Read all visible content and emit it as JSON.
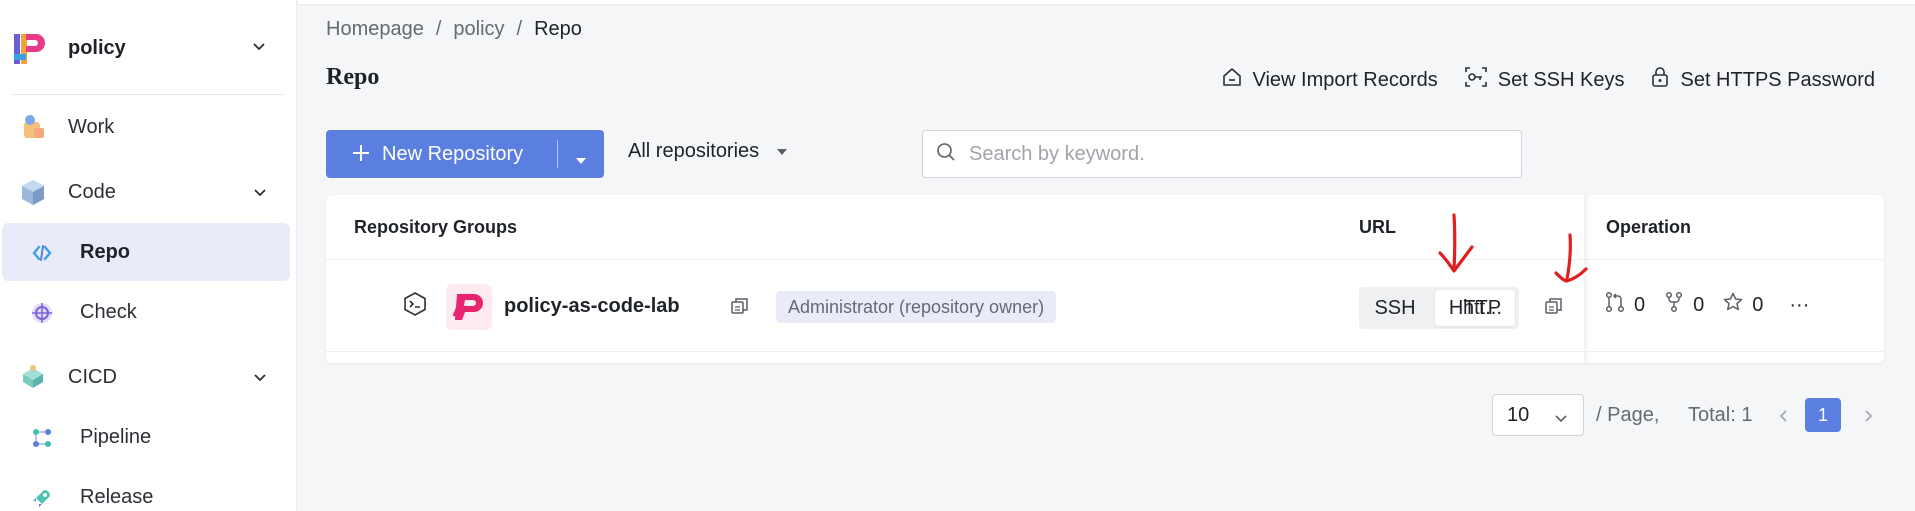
{
  "sidebar": {
    "project_name": "policy",
    "items": [
      {
        "label": "Work",
        "icon": "work-icon"
      },
      {
        "label": "Code",
        "icon": "code-icon"
      },
      {
        "label": "Repo",
        "icon": "repo-icon"
      },
      {
        "label": "Check",
        "icon": "check-icon"
      },
      {
        "label": "CICD",
        "icon": "cicd-icon"
      },
      {
        "label": "Pipeline",
        "icon": "pipeline-icon"
      },
      {
        "label": "Release",
        "icon": "release-icon"
      }
    ]
  },
  "breadcrumb": [
    "Homepage",
    "policy",
    "Repo"
  ],
  "breadcrumb_separator": "/",
  "page": {
    "title": "Repo",
    "actions": {
      "import_records": "View Import Records",
      "ssh_keys": "Set SSH Keys",
      "https_password": "Set HTTPS Password"
    }
  },
  "toolbar": {
    "new_repo_label": "New Repository",
    "filter_label": "All repositories",
    "search_placeholder": "Search by keyword."
  },
  "table": {
    "columns": {
      "group": "Repository Groups",
      "url": "URL",
      "operation": "Operation"
    },
    "rows": [
      {
        "name": "policy-as-code-lab",
        "role": "Administrator (repository owner)",
        "protocols": [
          "SSH",
          "HTTP"
        ],
        "selected_protocol": "HTTP",
        "url_text": "htt...",
        "merge_requests": "0",
        "forks": "0",
        "stars": "0",
        "more": "···"
      }
    ]
  },
  "pagination": {
    "page_size": "10",
    "per_page_label": "/ Page,",
    "total_label": "Total: 1",
    "current_page": "1"
  },
  "colors": {
    "accent": "#5b7fe0",
    "annotation": "#e02020",
    "active_nav_bg": "#e9ecf8"
  }
}
